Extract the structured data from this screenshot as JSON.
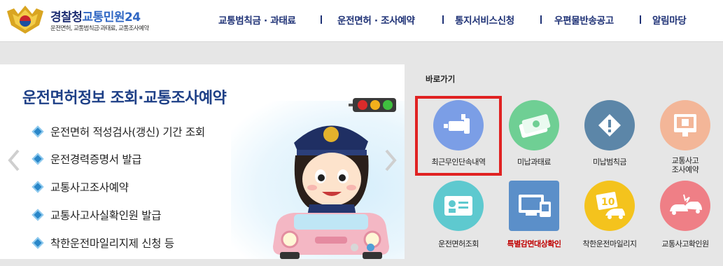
{
  "header": {
    "logo_title_part1": "경찰청",
    "logo_title_part2": "교통민원24",
    "logo_subtitle": "운전면허, 교통범칙금·과태료, 교통조사예약",
    "nav": [
      "교통범칙금 · 과태료",
      "운전면허 · 조사예약",
      "통지서비스신청",
      "우편물반송공고",
      "알림마당"
    ]
  },
  "banner": {
    "title": "운전면허정보 조회·교통조사예약",
    "items": [
      "운전면허 적성검사(갱신) 기간 조회",
      "운전경력증명서 발급",
      "교통사고조사예약",
      "교통사고사실확인원 발급",
      "착한운전마일리지제 신청 등"
    ]
  },
  "quick": {
    "label": "바로가기",
    "items": [
      {
        "label": "최근무인단속내역",
        "icon": "camera-icon",
        "color": "#7b9ee6"
      },
      {
        "label": "미납과태료",
        "icon": "money-icon",
        "color": "#6fcf94"
      },
      {
        "label": "미납범칙금",
        "icon": "warning-icon",
        "color": "#5c86a8"
      },
      {
        "label1": "교통사고",
        "label2": "조사예약",
        "icon": "monitor-icon",
        "color": "#f3b698"
      },
      {
        "label": "운전면허조회",
        "icon": "license-card-icon",
        "color": "#5ec9cf"
      },
      {
        "label": "특별감면대상확인",
        "icon": "computer-icon",
        "color": "#5b8fc9"
      },
      {
        "label": "착한운전마일리지",
        "icon": "mileage-icon",
        "color": "#f4c31d"
      },
      {
        "label": "교통사고확인원",
        "icon": "car-crash-icon",
        "color": "#ef7f86"
      }
    ]
  }
}
